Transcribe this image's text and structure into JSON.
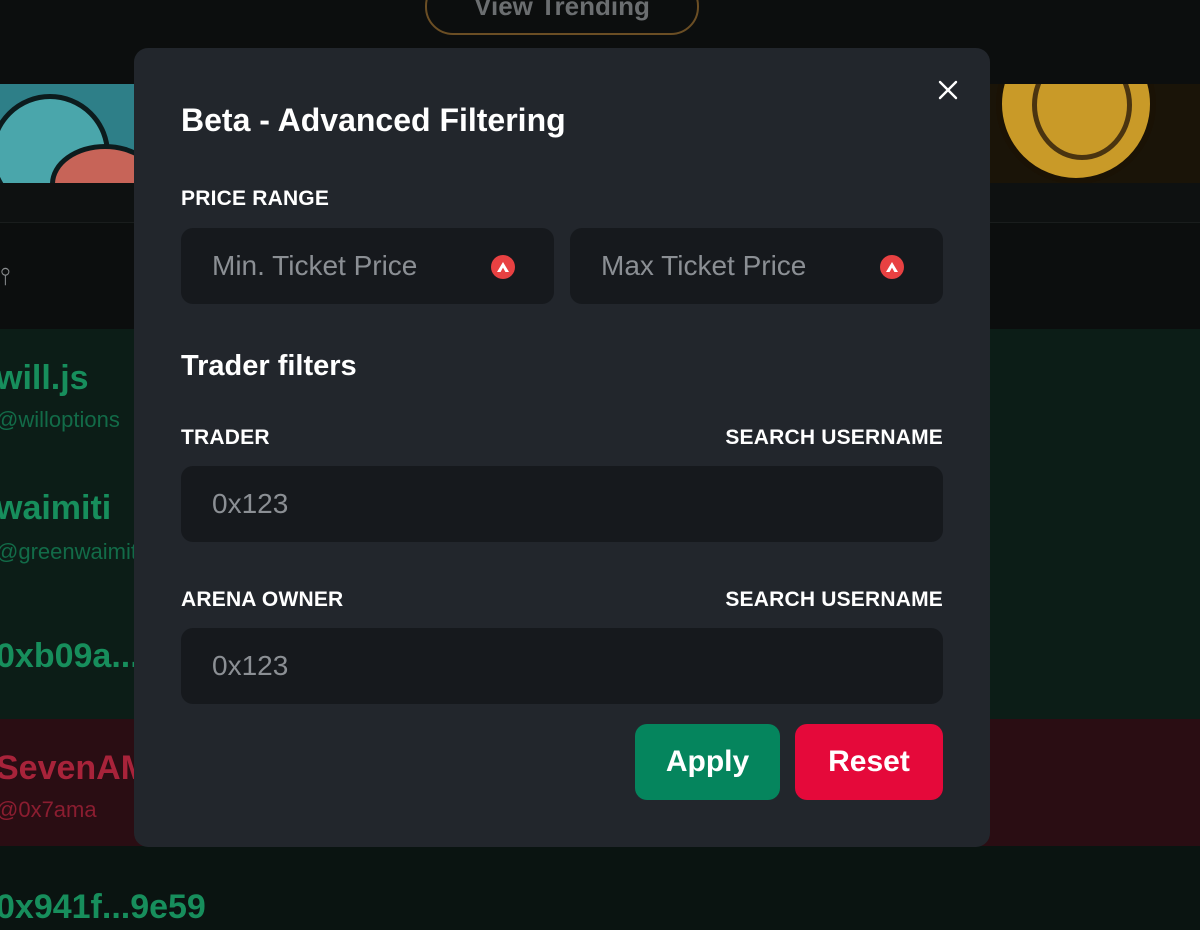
{
  "background": {
    "top_button_label": "View Trending",
    "rows": [
      {
        "name": "will.js",
        "handle": "@willoptions",
        "tone": "green"
      },
      {
        "name": "waimiti",
        "handle": "@greenwaimiti",
        "tone": "green"
      },
      {
        "name": "0xb09a...",
        "handle": "",
        "tone": "green"
      },
      {
        "name": "SevenAM",
        "handle": "@0x7ama",
        "tone": "red"
      },
      {
        "name": "0x941f...9e59",
        "handle": "",
        "tone": "dark"
      }
    ]
  },
  "modal": {
    "title": "Beta - Advanced Filtering",
    "close_icon": "close-icon",
    "price_range": {
      "label": "PRICE RANGE",
      "min_placeholder": "Min. Ticket Price",
      "max_placeholder": "Max Ticket Price",
      "currency_icon": "avax-icon"
    },
    "trader_filters_title": "Trader filters",
    "trader": {
      "label": "TRADER",
      "search_label": "SEARCH USERNAME",
      "placeholder": "0x123"
    },
    "arena_owner": {
      "label": "ARENA OWNER",
      "search_label": "SEARCH USERNAME",
      "placeholder": "0x123"
    },
    "apply_label": "Apply",
    "reset_label": "Reset"
  },
  "colors": {
    "modal_bg": "#22262c",
    "input_bg": "#16191d",
    "apply": "#05855d",
    "reset": "#e5093a",
    "avax": "#e84142"
  }
}
